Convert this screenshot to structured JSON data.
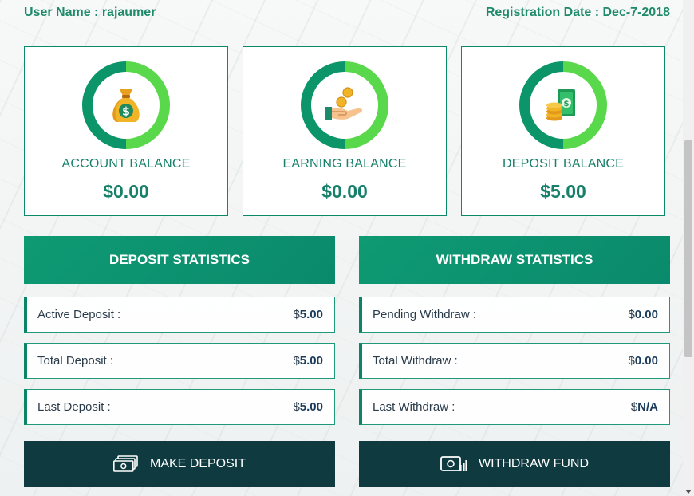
{
  "header": {
    "user_label": "User Name : rajaumer",
    "registration_label": "Registration Date : Dec-7-2018"
  },
  "cards": [
    {
      "label": "ACCOUNT BALANCE",
      "amount": "$0.00",
      "icon": "money-bag-icon"
    },
    {
      "label": "EARNING BALANCE",
      "amount": "$0.00",
      "icon": "coins-hand-icon"
    },
    {
      "label": "DEPOSIT BALANCE",
      "amount": "$5.00",
      "icon": "cash-coins-icon"
    }
  ],
  "deposit_stats": {
    "title": "DEPOSIT STATISTICS",
    "rows": [
      {
        "label": "Active Deposit :",
        "currency": "$",
        "value": "5.00"
      },
      {
        "label": "Total Deposit :",
        "currency": "$",
        "value": "5.00"
      },
      {
        "label": "Last Deposit :",
        "currency": "$",
        "value": "5.00"
      }
    ]
  },
  "withdraw_stats": {
    "title": "WITHDRAW STATISTICS",
    "rows": [
      {
        "label": "Pending Withdraw :",
        "currency": "$",
        "value": "0.00"
      },
      {
        "label": "Total Withdraw :",
        "currency": "$",
        "value": "0.00"
      },
      {
        "label": "Last Withdraw :",
        "currency": "$",
        "value": "N/A"
      }
    ]
  },
  "actions": {
    "deposit_label": "MAKE DEPOSIT",
    "withdraw_label": "WITHDRAW FUND"
  },
  "colors": {
    "brand_green": "#0b9568",
    "ring_light": "#5ad84c",
    "dark_button": "#0f3a3f"
  }
}
